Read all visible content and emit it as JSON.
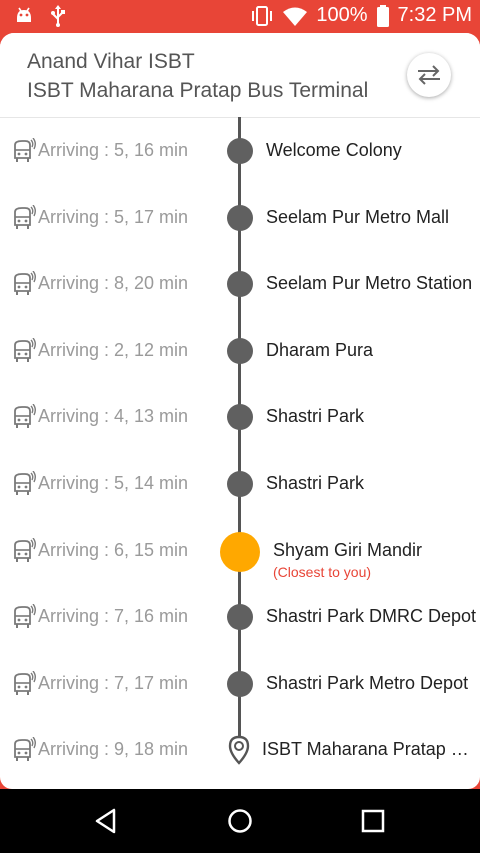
{
  "status_bar": {
    "battery_percent": "100%",
    "time": "7:32 PM",
    "icons": [
      "android-debug-icon",
      "usb-icon",
      "vibrate-icon",
      "wifi-icon",
      "battery-icon"
    ]
  },
  "route": {
    "from": "Anand Vihar ISBT",
    "to": "ISBT Maharana Pratap Bus Terminal",
    "swap_icon": "swap-arrows-icon"
  },
  "stops": [
    {
      "arrival": "Arriving : 5, 16 min",
      "name": "Welcome Colony"
    },
    {
      "arrival": "Arriving : 5, 17 min",
      "name": "Seelam Pur Metro Mall"
    },
    {
      "arrival": "Arriving : 8, 20 min",
      "name": "Seelam Pur Metro Station"
    },
    {
      "arrival": "Arriving : 2, 12 min",
      "name": "Dharam Pura"
    },
    {
      "arrival": "Arriving : 4, 13 min",
      "name": "Shastri Park"
    },
    {
      "arrival": "Arriving : 5, 14 min",
      "name": "Shastri Park"
    },
    {
      "arrival": "Arriving : 6, 15 min",
      "name": "Shyam Giri Mandir",
      "note": "(Closest to you)"
    },
    {
      "arrival": "Arriving : 7, 16 min",
      "name": "Shastri Park DMRC Depot"
    },
    {
      "arrival": "Arriving : 7, 17 min",
      "name": "Shastri Park Metro Depot"
    },
    {
      "arrival": "Arriving : 9, 18 min",
      "name": "ISBT Maharana Pratap B..."
    }
  ],
  "colors": {
    "accent": "#e84537",
    "closest_marker": "#ffa800",
    "stop_marker": "#606060"
  },
  "nav": {
    "back": "back-icon",
    "home": "home-icon",
    "recents": "recents-icon"
  }
}
